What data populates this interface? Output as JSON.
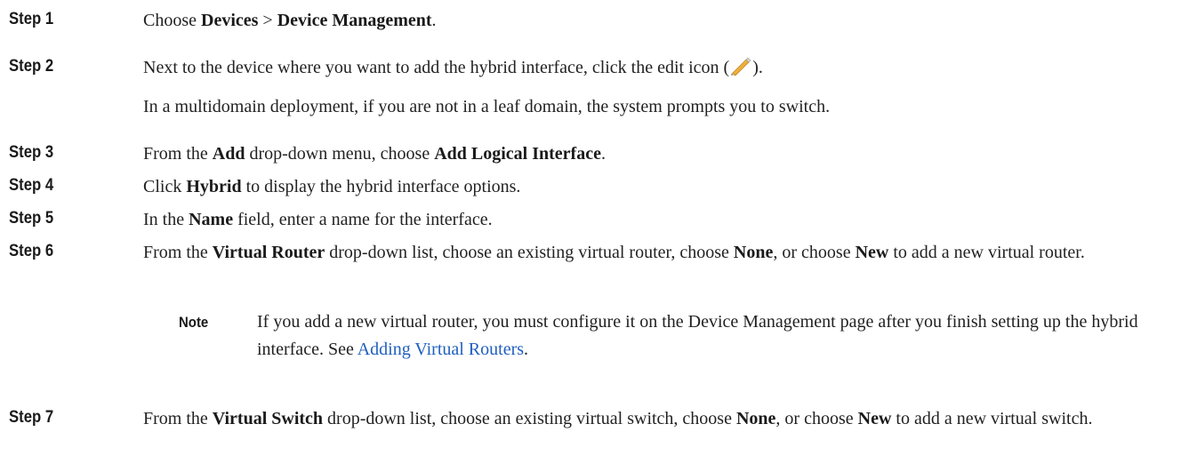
{
  "steps": [
    {
      "label": "Step 1",
      "parts": [
        "Choose ",
        "Devices",
        " > ",
        "Device Management",
        "."
      ]
    },
    {
      "label": "Step 2",
      "parts": [
        "Next to the device where you want to add the hybrid interface, click the edit icon (",
        ")."
      ],
      "sub": "In a multidomain deployment, if you are not in a leaf domain, the system prompts you to switch."
    },
    {
      "label": "Step 3",
      "parts": [
        "From the ",
        "Add",
        " drop-down menu, choose ",
        "Add Logical Interface",
        "."
      ]
    },
    {
      "label": "Step 4",
      "parts": [
        "Click ",
        "Hybrid",
        " to display the hybrid interface options."
      ]
    },
    {
      "label": "Step 5",
      "parts": [
        "In the ",
        "Name",
        " field, enter a name for the interface."
      ]
    },
    {
      "label": "Step 6",
      "parts": [
        "From the ",
        "Virtual Router",
        " drop-down list, choose an existing virtual router, choose ",
        "None",
        ", or choose ",
        "New",
        " to add a new virtual router."
      ],
      "note": {
        "label": "Note",
        "text": "If you add a new virtual router, you must configure it on the Device Management page after you finish setting up the hybrid interface. See ",
        "link": "Adding Virtual Routers",
        "end": "."
      }
    },
    {
      "label": "Step 7",
      "parts": [
        "From the ",
        "Virtual Switch",
        " drop-down list, choose an existing virtual switch, choose ",
        "None",
        ", or choose ",
        "New",
        " to add a new virtual switch."
      ]
    }
  ],
  "icons": {
    "edit": "pencil-edit-icon"
  },
  "colors": {
    "link": "#1f5fbf",
    "text": "#222222"
  }
}
